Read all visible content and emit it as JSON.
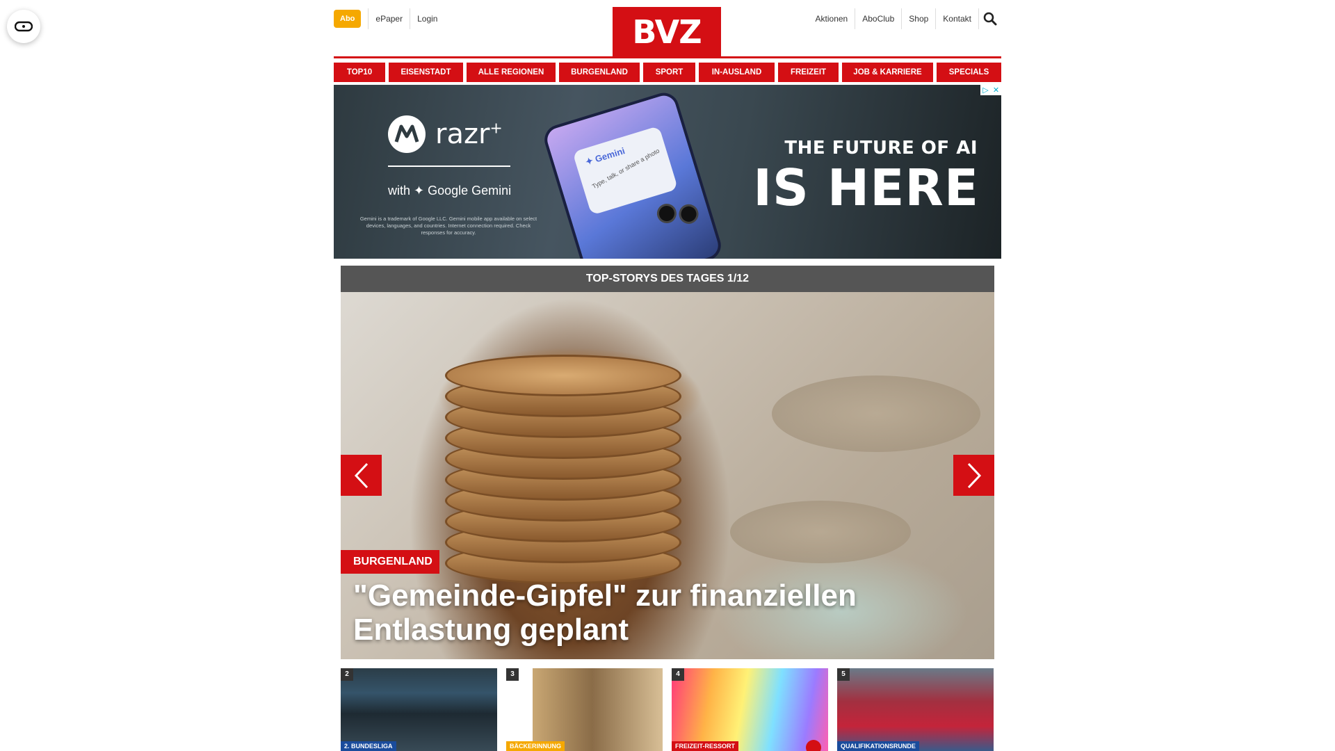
{
  "header": {
    "abo_label": "Abo",
    "epaper_label": "ePaper",
    "login_label": "Login",
    "logo_text": "BVZ",
    "right_links": [
      "Aktionen",
      "AboClub",
      "Shop",
      "Kontakt"
    ]
  },
  "nav": {
    "items": [
      "TOP10",
      "EISENSTADT",
      "ALLE REGIONEN",
      "BURGENLAND",
      "SPORT",
      "IN-AUSLAND",
      "FREIZEIT",
      "JOB & KARRIERE",
      "SPECIALS"
    ]
  },
  "ad": {
    "brand": "razr",
    "brand_sup": "+",
    "partner": "with ✦ Google Gemini",
    "fineprint": "Gemini is a trademark of Google LLC. Gemini mobile app available on select devices, languages, and countries. Internet connection required. Check responses for accuracy.",
    "phone_app": "✦ Gemini",
    "phone_prompt": "Type, talk, or share a photo",
    "headline_small": "THE FUTURE OF AI",
    "headline_large": "IS HERE"
  },
  "top_stories": {
    "header": "TOP-STORYS DES TAGES 1/12",
    "category": "BURGENLAND",
    "title": "\"Gemeinde-Gipfel\" zur finanziellen Entlastung geplant"
  },
  "thumbnails": [
    {
      "num": "2",
      "category": "2. BUNDESLIGA",
      "cat_color": "#1a4c9c"
    },
    {
      "num": "3",
      "category": "BÄCKERINNUNG",
      "cat_color": "#f5a800"
    },
    {
      "num": "4",
      "category": "FREIZEIT-RESSORT",
      "cat_color": "#d40f14"
    },
    {
      "num": "5",
      "category": "QUALIFIKATIONSRUNDE",
      "cat_color": "#1a4c9c"
    }
  ],
  "colors": {
    "brand_red": "#d40f14",
    "abo_orange": "#f5a800",
    "story_header_gray": "#555555"
  }
}
